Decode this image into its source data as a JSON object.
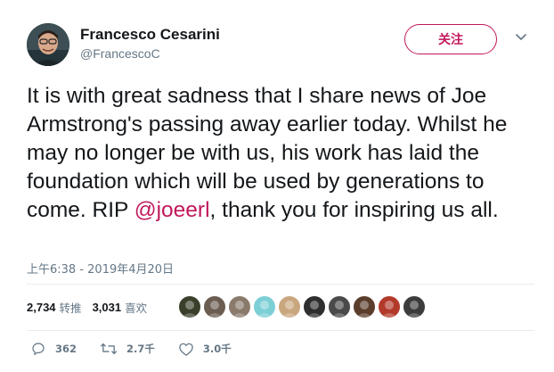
{
  "user": {
    "display_name": "Francesco Cesarini",
    "handle": "@FrancescoC",
    "follow_label": "关注"
  },
  "tweet": {
    "text_before_mention": "It is with great sadness that I share news of Joe Armstrong's passing away earlier today. Whilst he may no longer be with us, his work has laid the foundation which will be used by generations to come. RIP ",
    "mention": "@joeerl",
    "text_after_mention": ", thank you for inspiring us all.",
    "timestamp": "上午6:38 - 2019年4月20日"
  },
  "stats": {
    "retweets_count": "2,734",
    "retweets_label": "转推",
    "likes_count": "3,031",
    "likes_label": "喜欢"
  },
  "likers": [
    {
      "color": "#3a3f2b"
    },
    {
      "color": "#6b5d52"
    },
    {
      "color": "#8a7a6c"
    },
    {
      "color": "#7dcfd6"
    },
    {
      "color": "#c9a77e"
    },
    {
      "color": "#2e2e2e"
    },
    {
      "color": "#4a4a4a"
    },
    {
      "color": "#5a3d2b"
    },
    {
      "color": "#b23a2a"
    },
    {
      "color": "#3c3c3c"
    }
  ],
  "actions": {
    "reply_count": "362",
    "retweet_count": "2.7千",
    "like_count": "3.0千"
  },
  "colors": {
    "accent": "#c2185b",
    "secondary_text": "#657786",
    "divider": "#e6ecf0"
  }
}
